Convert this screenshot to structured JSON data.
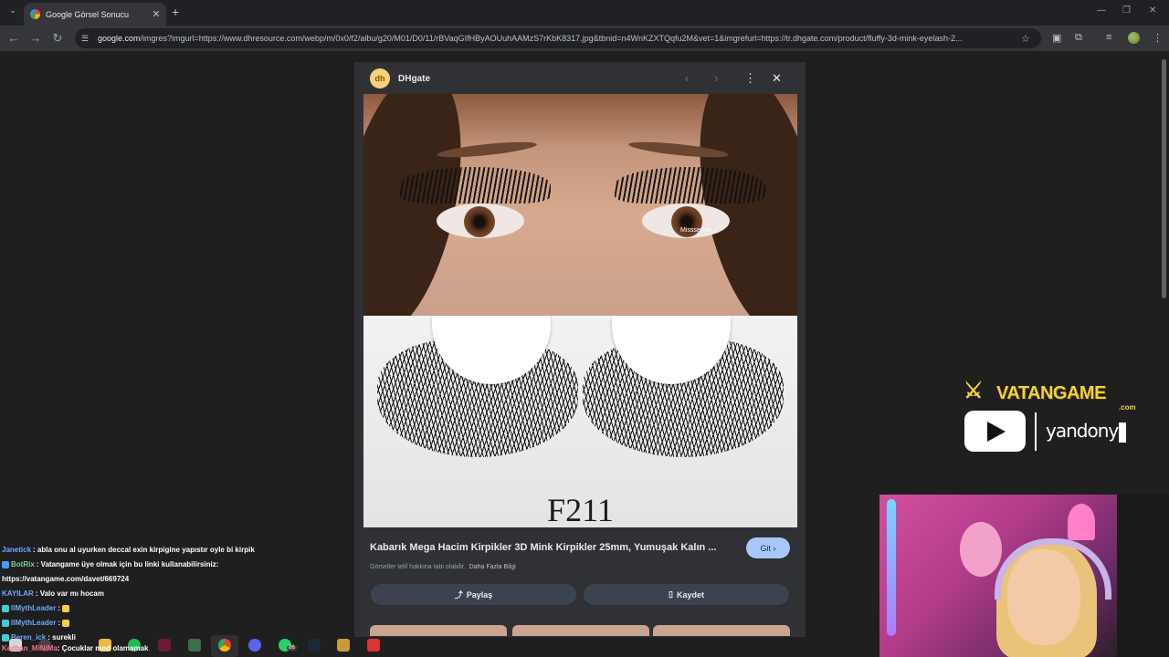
{
  "browser": {
    "tab_title": "Google Görsel Sonucu",
    "tab_close": "✕",
    "new_tab": "+",
    "url_host": "google.com",
    "url_rest": "/imgres?imgurl=https://www.dhresource.com/webp/m/0x0/f2/albu/g20/M01/D0/11/rBVaqGIfHByAOUuhAAMzS7rKbK8317.jpg&tbnid=n4WnKZXTQqfu2M&vet=1&imgrefurl=https://tr.dhgate.com/product/fluffy-3d-mink-eyelash-2..."
  },
  "panel": {
    "source_name": "DHgate",
    "source_logo": "dh",
    "image_watermark": "Misssecret",
    "image_code": "F211",
    "title": "Kabarık Mega Hacim Kirpikler 3D Mink Kirpikler 25mm, Yumuşak Kalın ...",
    "go_label": "Git ›",
    "copyright_note": "Görseller telif hakkına tabi olabilir.",
    "more_info": "Daha Fazla Bilgi",
    "share_label": "Paylaş",
    "save_label": "Kaydet",
    "share_icon": "share-icon",
    "save_icon": "bookmark-icon"
  },
  "chat": [
    {
      "user": "Janetick",
      "color": "#6ea8ff",
      "message": ": abla onu al uyurken deccal exin kirpigine yapıstır oyle bi kirpik",
      "badge": ""
    },
    {
      "user": "BotRix",
      "color": "#7fd18a",
      "message": ": Vatangame üye olmak için bu linki kullanabilirsiniz:",
      "badge": "#3fa2ff"
    },
    {
      "user": "",
      "color": "#fff",
      "message": "https://vatangame.com/davet/669724",
      "badge": ""
    },
    {
      "user": "KAYILAR",
      "color": "#6ea8ff",
      "message": ": Valo var mı hocam",
      "badge": ""
    },
    {
      "user": "llMythLeader",
      "color": "#6ea8ff",
      "message": ": ",
      "badge": "#3fd0d0"
    },
    {
      "user": "llMythLeader",
      "color": "#6ea8ff",
      "message": ": ",
      "badge": "#3fd0d0"
    },
    {
      "user": "Beren_ick",
      "color": "#6ea8ff",
      "message": ": surekli",
      "badge": "#3fd0d0"
    }
  ],
  "overlay": {
    "last_message_user": "Kezban_MiNiMa",
    "last_message_text": ": Çocuklar mod olamamak",
    "brand": "VATANGAME",
    "brand_suffix": ".com",
    "channel": "yandony"
  },
  "taskbar": {
    "badge_count": "86"
  },
  "colors": {
    "go_button": "#a8c7fa",
    "brand_yellow": "#f3d23a",
    "panel_bg": "#303134"
  }
}
